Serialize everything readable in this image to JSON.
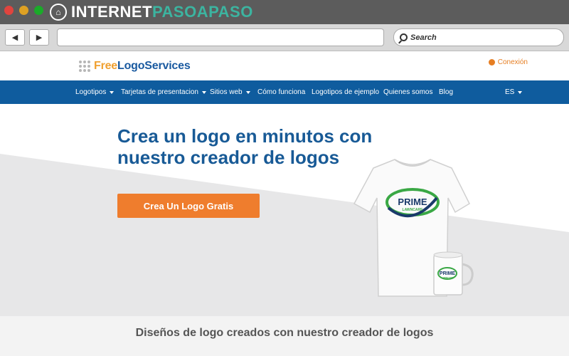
{
  "watermark": {
    "name_a": "INTERNET",
    "name_b": "PASOAPASO",
    "badge_icon": "shield-icon"
  },
  "browser": {
    "back_glyph": "◀",
    "forward_glyph": "▶",
    "search_placeholder": "Search"
  },
  "site": {
    "logo_free": "Free",
    "logo_rest": "LogoServices",
    "login_label": "Conexión"
  },
  "nav": {
    "items": [
      {
        "label": "Logotipos",
        "has_caret": true
      },
      {
        "label": "Tarjetas de presentacion",
        "has_caret": true
      },
      {
        "label": "Sitios web",
        "has_caret": true
      },
      {
        "label": "Cómo funciona",
        "has_caret": false
      },
      {
        "label": "Logotipos de ejemplo",
        "has_caret": false
      },
      {
        "label": "Quienes somos",
        "has_caret": false
      },
      {
        "label": "Blog",
        "has_caret": false
      }
    ],
    "language": "ES"
  },
  "hero": {
    "title_line1": "Crea un logo en minutos con",
    "title_line2": "nuestro creador de logos",
    "cta_label": "Crea Un Logo Gratis",
    "mockup_brand": "PRIME",
    "mockup_sub": "LAWNCARE"
  },
  "footer": {
    "title": "Diseños de logo creados con nuestro creador de logos"
  },
  "colors": {
    "nav_bg": "#0f5c9e",
    "cta_bg": "#ef7d2d",
    "title": "#185a96",
    "accent_orange": "#e67e22"
  }
}
